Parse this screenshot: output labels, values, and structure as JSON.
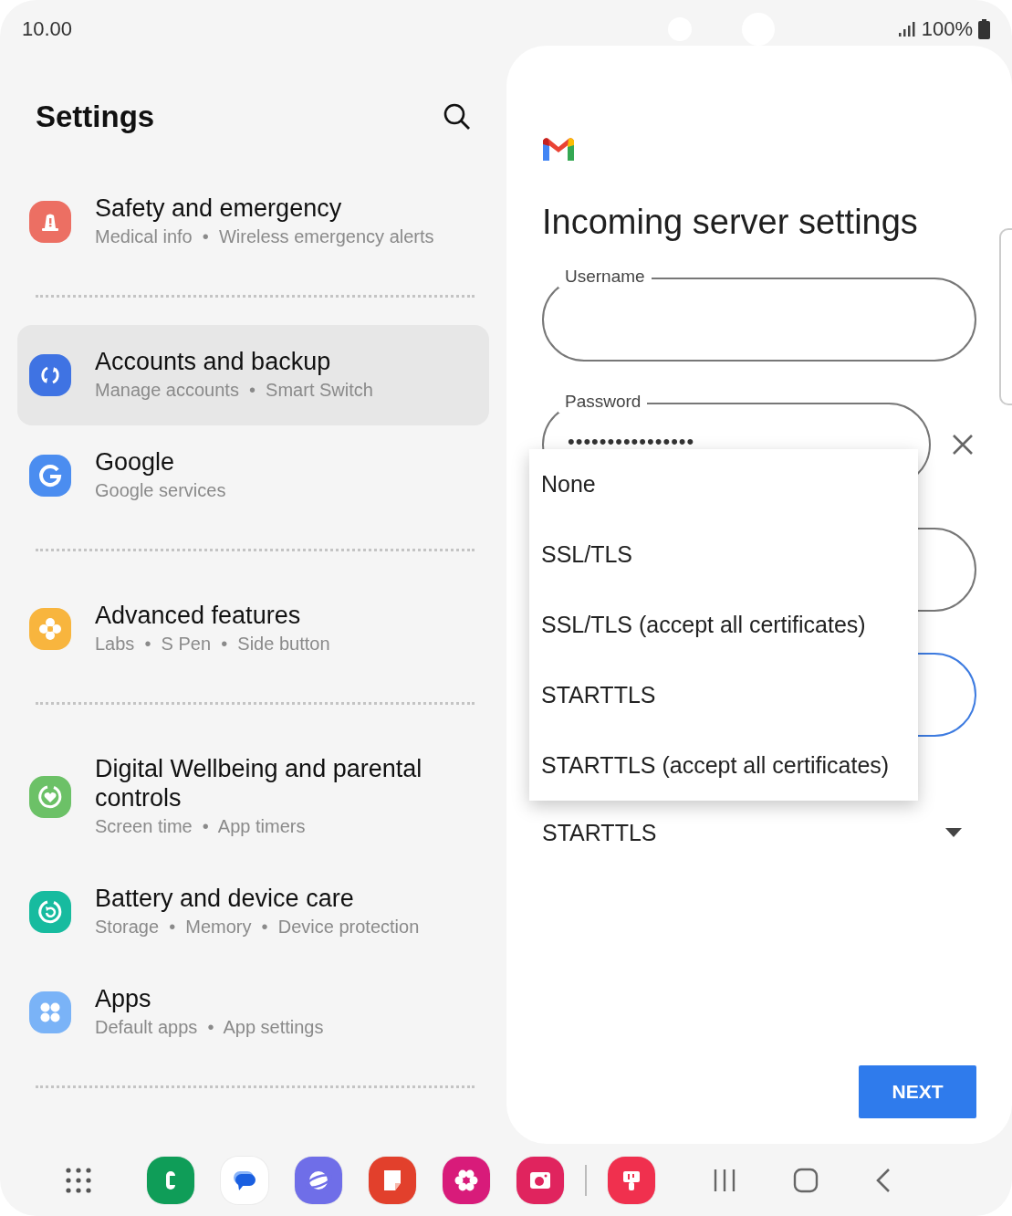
{
  "status_bar": {
    "time": "10.00",
    "battery": "100%"
  },
  "settings": {
    "title": "Settings",
    "groups": [
      {
        "items": [
          {
            "title": "Safety and emergency",
            "details": "Medical info  •  Wireless emergency alerts",
            "color": "#ec6f63",
            "selected": false
          }
        ]
      },
      {
        "items": [
          {
            "title": "Accounts and backup",
            "details": "Manage accounts  •  Smart Switch",
            "color": "#3f73e3",
            "selected": true
          },
          {
            "title": "Google",
            "details": "Google services",
            "color": "#4b8df0",
            "selected": false
          }
        ]
      },
      {
        "items": [
          {
            "title": "Advanced features",
            "details": "Labs  •  S Pen  •  Side button",
            "color": "#f8b53e",
            "selected": false
          }
        ]
      },
      {
        "items": [
          {
            "title": "Digital Wellbeing and parental controls",
            "details": "Screen time  •  App timers",
            "color": "#6cc167",
            "selected": false
          },
          {
            "title": "Battery and device care",
            "details": "Storage  •  Memory  •  Device protection",
            "color": "#17bb9f",
            "selected": false
          },
          {
            "title": "Apps",
            "details": "Default apps  •  App settings",
            "color": "#7ab3f7",
            "selected": false
          }
        ]
      }
    ]
  },
  "server_settings": {
    "title": "Incoming server settings",
    "fields": [
      {
        "kind": "text",
        "label": "Username",
        "focused": false
      },
      {
        "kind": "password",
        "label": "Password",
        "value": "••••••••••••••••",
        "focused": false,
        "clearable": true
      },
      {
        "kind": "text",
        "focused": false
      },
      {
        "kind": "text",
        "focused": true
      },
      {
        "kind": "dropdown",
        "value": "STARTTLS",
        "focused": false
      }
    ],
    "next_button": "NEXT"
  },
  "security_menu": {
    "options": [
      "None",
      "SSL/TLS",
      "SSL/TLS (accept all certificates)",
      "STARTTLS",
      "STARTTLS (accept all certificates)"
    ]
  },
  "dock": {
    "pinned_apps": [
      {
        "color": "#0f9d58"
      },
      {
        "color": "#ffffff"
      },
      {
        "color": "#6f6ee8"
      },
      {
        "color": "#e2402c"
      },
      {
        "color": "#d81b7a"
      },
      {
        "color": "#e0245e"
      }
    ],
    "recent_apps": [
      {
        "color": "#f0304e"
      }
    ]
  }
}
